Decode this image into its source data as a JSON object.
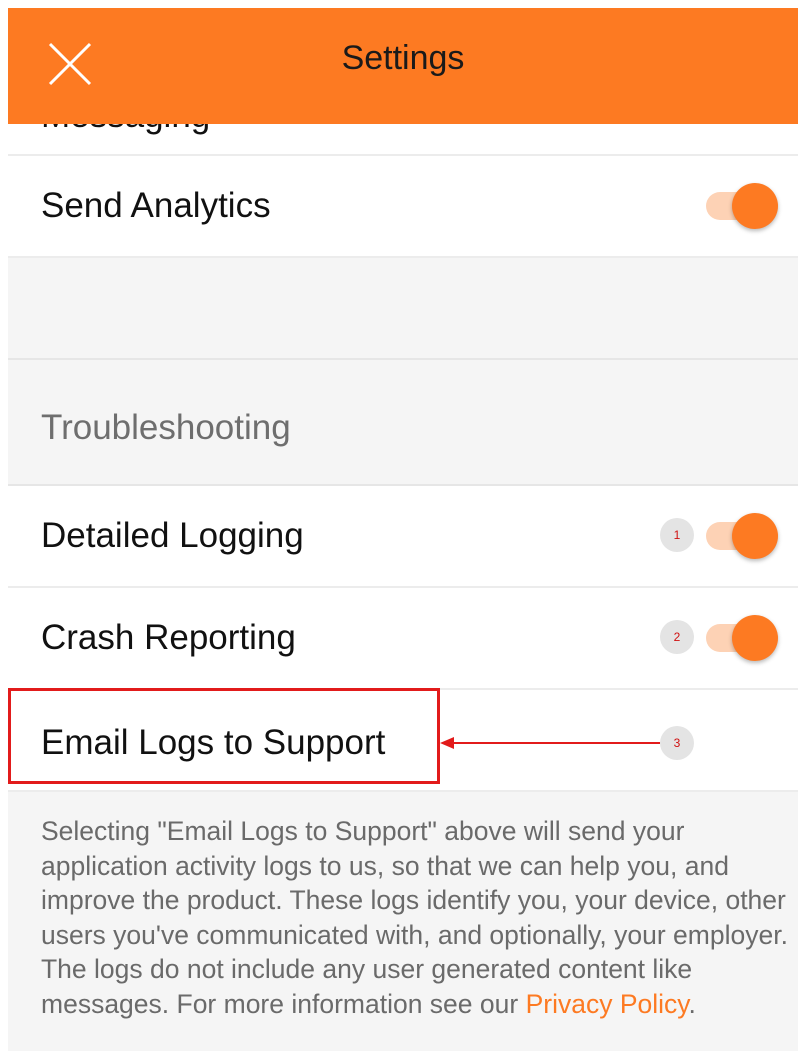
{
  "header": {
    "title": "Settings",
    "close_icon": "close-icon"
  },
  "rows": {
    "partial_label": "Messaging",
    "send_analytics": {
      "label": "Send Analytics",
      "enabled": true
    },
    "troubleshooting_header": "Troubleshooting",
    "detailed_logging": {
      "label": "Detailed Logging",
      "enabled": true,
      "badge": "1"
    },
    "crash_reporting": {
      "label": "Crash Reporting",
      "enabled": true,
      "badge": "2"
    },
    "email_logs": {
      "label": "Email Logs to Support",
      "badge": "3"
    }
  },
  "footer": {
    "description": "Selecting \"Email Logs to Support\" above will send your application activity logs to us, so that we can help you, and improve the product. These logs identify you, your device, other users you've communicated with, and optionally, your employer. The logs do not include any user generated content like messages. For more information see our",
    "link_text": "Privacy Policy",
    "trailing": "."
  },
  "colors": {
    "accent": "#fd7a22",
    "toggle_track": "#fdd2b5",
    "annotation_red": "#e21b1b",
    "background": "#f5f5f5"
  }
}
